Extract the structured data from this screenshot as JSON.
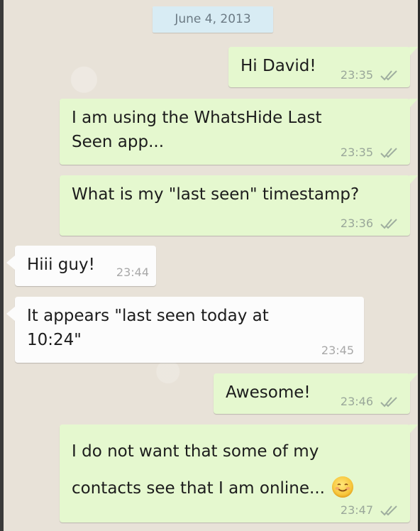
{
  "date_chip": "June 4, 2013",
  "messages": [
    {
      "direction": "outgoing",
      "lines": [
        "Hi David!"
      ],
      "time": "23:35",
      "ticks": "double-check-icon"
    },
    {
      "direction": "outgoing",
      "lines": [
        "I am using the WhatsHide Last",
        "Seen app..."
      ],
      "time": "23:35",
      "ticks": "double-check-icon"
    },
    {
      "direction": "outgoing",
      "lines": [
        "What is my \"last seen\" timestamp?"
      ],
      "time": "23:36",
      "ticks": "double-check-icon"
    },
    {
      "direction": "incoming",
      "lines": [
        "Hiii guy!"
      ],
      "time": "23:44"
    },
    {
      "direction": "incoming",
      "lines": [
        "It appears \"last seen today at",
        "10:24\""
      ],
      "time": "23:45"
    },
    {
      "direction": "outgoing",
      "lines": [
        "Awesome!"
      ],
      "time": "23:46",
      "ticks": "double-check-icon"
    },
    {
      "direction": "outgoing",
      "lines": [
        "I do not want that some of my",
        "contacts see that I am online..."
      ],
      "emoji": "smiling-face-icon",
      "time": "23:47",
      "ticks": "double-check-icon"
    }
  ],
  "colors": {
    "outgoing_bubble": "#e5f8cf",
    "incoming_bubble": "#fcfcfc",
    "date_chip": "#d8ecf4",
    "wallpaper": "#e8e2d8"
  }
}
